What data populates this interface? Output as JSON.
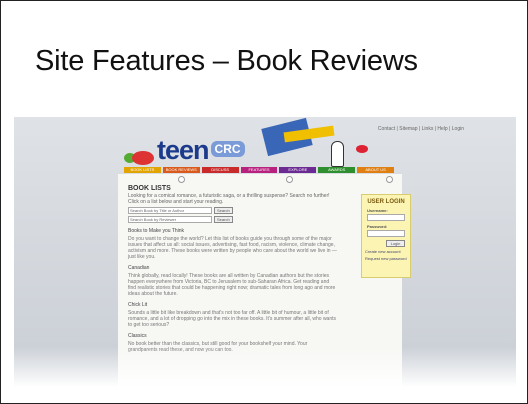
{
  "slide": {
    "title": "Site Features – Book Reviews"
  },
  "site": {
    "utility_links": "Contact | Sitemap | Links | Help | Login",
    "logo_text": "teen",
    "logo_suffix": "CRC",
    "nav": [
      {
        "label": "BOOK LISTS",
        "color": "#e2a400"
      },
      {
        "label": "BOOK REVIEWS",
        "color": "#d95a1a"
      },
      {
        "label": "DISCUSS",
        "color": "#c92b2b"
      },
      {
        "label": "FEATURES",
        "color": "#b8227f"
      },
      {
        "label": "EXPLORE",
        "color": "#6b2b93"
      },
      {
        "label": "AWARDS",
        "color": "#2f8f2f"
      },
      {
        "label": "ABOUT US",
        "color": "#e07f12"
      }
    ],
    "main": {
      "heading": "BOOK LISTS",
      "intro": "Looking for a comical romance, a futuristic saga, or a thrilling suspense? Search no further! Click on a list below and start your reading.",
      "search1_placeholder": "Search Book by Title or Author",
      "search2_placeholder": "Search Book by Reviewer",
      "search_button": "Search",
      "sections": [
        {
          "heading": "Books to Make you Think",
          "text": "Do you want to change the world? Let this list of books guide you through some of the major issues that affect us all: social issues, advertising, fast food, racism, violence, climate change, activism and more. These books were written by people who care about the world we live in — just like you."
        },
        {
          "heading": "Canadian",
          "text": "Think globally, read locally! These books are all written by Canadian authors but the stories happen everywhere from Victoria, BC to Jerusalem to sub-Saharan Africa. Get reading and find realistic stories that could be happening right now; dramatic tales from long ago and more ideas about the future."
        },
        {
          "heading": "Chick Lit",
          "text": "Sounds a little bit like breakdown and that's not too far off. A little bit of humour, a little bit of romance, and a lot of dropping go into the mix in these books. It's summer after all, who wants to get too serious?"
        },
        {
          "heading": "Classics",
          "text": "No book better than the classics, but still good for your bookshelf your mind. Your grandparents read these, and now you can too."
        }
      ]
    },
    "login": {
      "title": "USER LOGIN",
      "username_label": "Username:",
      "password_label": "Password:",
      "login_button": "Login",
      "create_account": "Create new account",
      "request_password": "Request new password"
    }
  }
}
